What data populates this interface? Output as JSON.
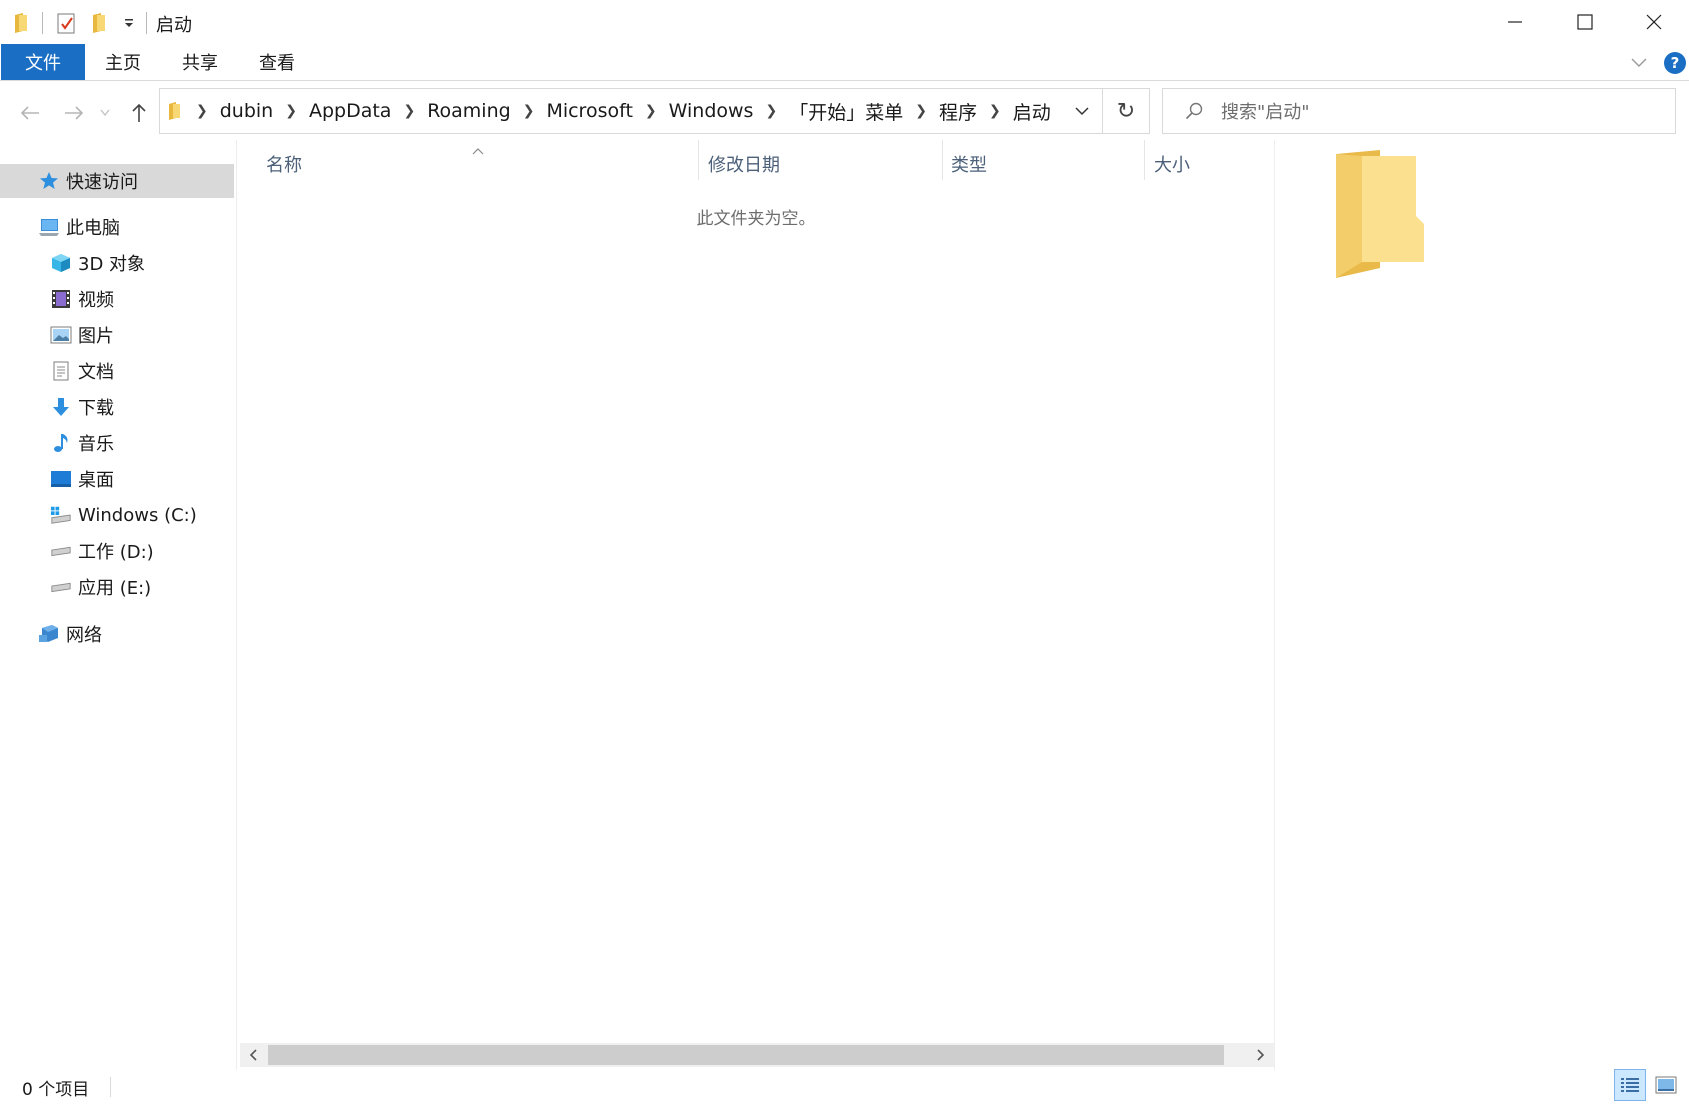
{
  "window": {
    "title": "启动",
    "controls": {
      "minimize": "minimize-icon",
      "maximize": "maximize-icon",
      "close": "close-icon"
    }
  },
  "ribbon": {
    "tabs": [
      {
        "label": "文件",
        "active": true
      },
      {
        "label": "主页"
      },
      {
        "label": "共享"
      },
      {
        "label": "查看"
      }
    ],
    "help_label": "?"
  },
  "address": {
    "crumbs": [
      "dubin",
      "AppData",
      "Roaming",
      "Microsoft",
      "Windows",
      "「开始」菜单",
      "程序",
      "启动"
    ]
  },
  "search": {
    "placeholder": "搜索\"启动\""
  },
  "sidebar": {
    "quick_access": "快速访问",
    "this_pc": "此电脑",
    "items": [
      {
        "label": "3D 对象",
        "icon": "3d-objects-icon"
      },
      {
        "label": "视频",
        "icon": "video-icon"
      },
      {
        "label": "图片",
        "icon": "pictures-icon"
      },
      {
        "label": "文档",
        "icon": "documents-icon"
      },
      {
        "label": "下载",
        "icon": "downloads-icon"
      },
      {
        "label": "音乐",
        "icon": "music-icon"
      },
      {
        "label": "桌面",
        "icon": "desktop-icon"
      },
      {
        "label": "Windows (C:)",
        "icon": "drive-c-icon"
      },
      {
        "label": "工作 (D:)",
        "icon": "drive-icon"
      },
      {
        "label": "应用 (E:)",
        "icon": "drive-icon"
      }
    ],
    "network": "网络"
  },
  "content": {
    "columns": {
      "name": "名称",
      "modified": "修改日期",
      "type": "类型",
      "size": "大小"
    },
    "empty_message": "此文件夹为空。"
  },
  "status": {
    "item_count": "0 个项目"
  },
  "colors": {
    "accent": "#1a6fc5",
    "selected_bg": "#d9d9d9",
    "folder": "#f8d775",
    "header_text": "#4c607a"
  }
}
